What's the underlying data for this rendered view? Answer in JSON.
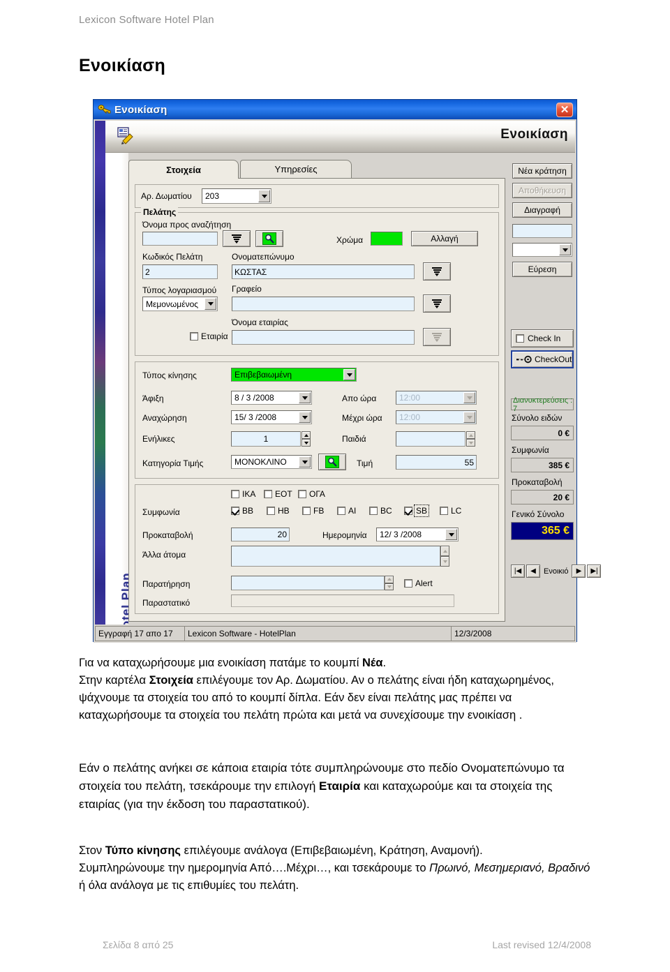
{
  "document": {
    "header": "Lexicon Software Hotel Plan",
    "title": "Ενοικίαση",
    "footer_left": "Σελίδα 8 από 25",
    "footer_right": "Last revised 12/4/2008"
  },
  "window": {
    "titlebar_text": "Ενοικίαση",
    "close_label": "✕",
    "toolbar_title": "Ενοικίαση",
    "banner_text": "Hotel Plan"
  },
  "tabs": [
    {
      "label": "Στοιχεία",
      "active": true
    },
    {
      "label": "Υπηρεσίες",
      "active": false
    }
  ],
  "room": {
    "label": "Αρ. Δωματίου",
    "value": "203"
  },
  "customer": {
    "group_label": "Πελάτης",
    "search_name_label": "Όνομα προς αναζήτηση",
    "search_name_value": "",
    "color_label": "Χρώμα",
    "color_value": "#00e600",
    "change_button": "Αλλαγή",
    "code_label": "Κωδικός Πελάτη",
    "code_value": "2",
    "fullname_label": "Ονοματεπώνυμο",
    "fullname_value": "ΚΩΣΤΑΣ",
    "account_type_label": "Τύπος λογαριασμού",
    "account_type_value": "Μεμονωμένος",
    "office_label": "Γραφείο",
    "office_value": "",
    "company_name_label": "Όνομα εταιρίας",
    "company_name_value": "",
    "company_checkbox": "Εταιρία",
    "company_checked": false
  },
  "booking": {
    "movement_type_label": "Τύπος κίνησης",
    "movement_type_value": "Επιβεβαιωμένη",
    "arrival_label": "Άφιξη",
    "arrival_value": "8 / 3 /2008",
    "from_hour_label": "Απο ώρα",
    "from_hour_value": "12:00",
    "departure_label": "Αναχώρηση",
    "departure_value": "15/ 3 /2008",
    "to_hour_label": "Μέχρι ώρα",
    "to_hour_value": "12:00",
    "adults_label": "Ενήλικες",
    "adults_value": "1",
    "children_label": "Παιδιά",
    "children_value": "",
    "price_category_label": "Κατηγορία Τιμής",
    "price_category_value": "ΜΟΝΟΚΛΙΝΟ",
    "price_label": "Τιμή",
    "price_value": "55"
  },
  "agreement": {
    "label": "Συμφωνία",
    "org_checks": [
      {
        "label": "ΙΚΑ",
        "checked": false
      },
      {
        "label": "ΕΟΤ",
        "checked": false
      },
      {
        "label": "ΟΓΑ",
        "checked": false
      }
    ],
    "meal_checks": [
      {
        "label": "BB",
        "checked": true,
        "focus": false
      },
      {
        "label": "HB",
        "checked": false,
        "focus": false
      },
      {
        "label": "FB",
        "checked": false,
        "focus": false
      },
      {
        "label": "AI",
        "checked": false,
        "focus": false
      },
      {
        "label": "BC",
        "checked": false,
        "focus": false
      },
      {
        "label": "SB",
        "checked": true,
        "focus": true
      },
      {
        "label": "LC",
        "checked": false,
        "focus": false
      }
    ]
  },
  "payment": {
    "deposit_label": "Προκαταβολή",
    "deposit_value": "20",
    "date_label": "Ημερομηνία",
    "date_value": "12/ 3 /2008",
    "other_people_label": "Άλλα άτομα",
    "other_people_value": "",
    "remark_label": "Παρατήρηση",
    "remark_value": "",
    "alert_label": "Alert",
    "alert_checked": false,
    "document_label": "Παραστατικό",
    "document_value": ""
  },
  "actions": {
    "new_booking": "Νέα κράτηση",
    "save": "Αποθήκευση",
    "delete": "Διαγραφή",
    "filter_text": "",
    "filter_select": "",
    "find": "Εύρεση",
    "check_in_label": "Check In",
    "check_in_checked": false,
    "checkout_label": "CheckOut"
  },
  "totals": {
    "nights": "Διανυκτερεύσεις : 7",
    "items_label": "Σύνολο ειδών",
    "items_value": "0 €",
    "agreement_label": "Συμφωνία",
    "agreement_value": "385 €",
    "deposit_label": "Προκαταβολή",
    "deposit_value": "20 €",
    "grand_label": "Γενικό Σύνολο",
    "grand_value": "365 €"
  },
  "navigator": {
    "first": "|◀",
    "prev": "◀",
    "label": "Ενοικιό",
    "next": "▶",
    "last": "▶|"
  },
  "statusbar": {
    "record": "Εγγραφή 17 απο 17",
    "app": "Lexicon Software - HotelPlan",
    "date": "12/3/2008"
  },
  "body": {
    "p1_l1_a": "Για να καταχωρήσουμε μια ενοικίαση πατάμε το κουμπί ",
    "p1_l1_b": "Νέα",
    "p1_l1_c": ".",
    "p1_l2_a": "Στην καρτέλα ",
    "p1_l2_b": "Στοιχεία",
    "p1_l2_c": " επιλέγουμε τον Αρ. Δωματίου. Αν ο πελάτης είναι ήδη καταχωρημένος, ψάχνουμε τα στοιχεία του από το κουμπί  δίπλα.",
    "p1_l3": "Εάν δεν είναι πελάτης μας πρέπει να καταχωρήσουμε τα στοιχεία του πελάτη πρώτα και μετά να συνεχίσουμε την ενοικίαση .",
    "p2_a": "Εάν ο πελάτης ανήκει σε κάποια εταιρία τότε συμπληρώνουμε στο πεδίο Ονοματεπώνυμο τα στοιχεία του πελάτη, τσεκάρουμε την επιλογή ",
    "p2_b": "Εταιρία",
    "p2_c": " και καταχωρούμε και τα στοιχεία της εταιρίας (για την έκδοση του παραστατικού).",
    "p3_a": "Στον ",
    "p3_b": "Τύπο κίνησης",
    "p3_c": " επιλέγουμε ανάλογα (Επιβεβαιωμένη, Κράτηση, Αναμονή).",
    "p3_d": "Συμπληρώνουμε την ημερομηνία  Από….Μέχρι…, και  τσεκάρουμε το ",
    "p3_e": "Πρωινό, Μεσημεριανό, Βραδινό",
    "p3_f": " ή όλα  ανάλογα με τις επιθυμίες του πελάτη."
  }
}
